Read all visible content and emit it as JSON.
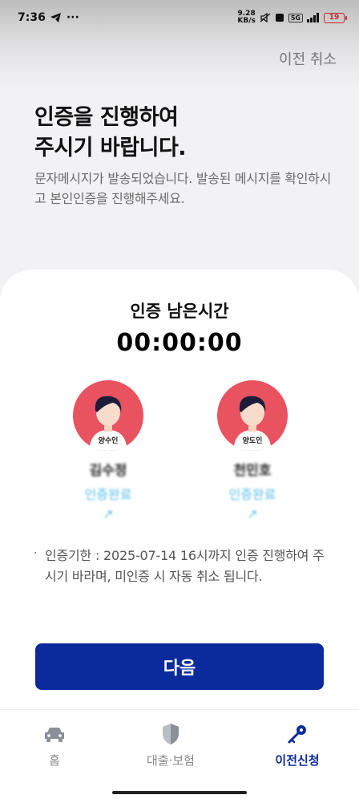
{
  "status_bar": {
    "time": "7:36",
    "more": "···",
    "net_speed_value": "9.28",
    "net_speed_unit": "KB/s",
    "network_badge": "5G",
    "battery": "19"
  },
  "header": {
    "cancel_label": "이전 취소"
  },
  "intro": {
    "title": "인증을 진행하여\n주시기 바랍니다.",
    "description": "문자메시지가 발송되었습니다. 발송된 메시지를 확인하시고 본인인증을 진행해주세요."
  },
  "timer": {
    "label": "인증 남은시간",
    "value": "00:00:00"
  },
  "parties": [
    {
      "role": "양수인",
      "name": "김수정",
      "status": "인증완료\n↗"
    },
    {
      "role": "양도인",
      "name": "천민호",
      "status": "인증완료\n↗"
    }
  ],
  "notice": {
    "bullet": "·",
    "text": "인증기한 : 2025-07-14 16시까지 인증 진행하여 주시기 바라며, 미인증 시 자동 취소 됩니다."
  },
  "actions": {
    "next_label": "다음"
  },
  "bottom_nav": {
    "items": [
      {
        "label": "홈",
        "icon": "car-icon"
      },
      {
        "label": "대출·보험",
        "icon": "shield-icon"
      },
      {
        "label": "이전신청",
        "icon": "key-icon",
        "active": true
      }
    ]
  },
  "colors": {
    "primary": "#0b2a9c",
    "avatar_bg": "#e9525f",
    "link": "#5bc0ea"
  }
}
